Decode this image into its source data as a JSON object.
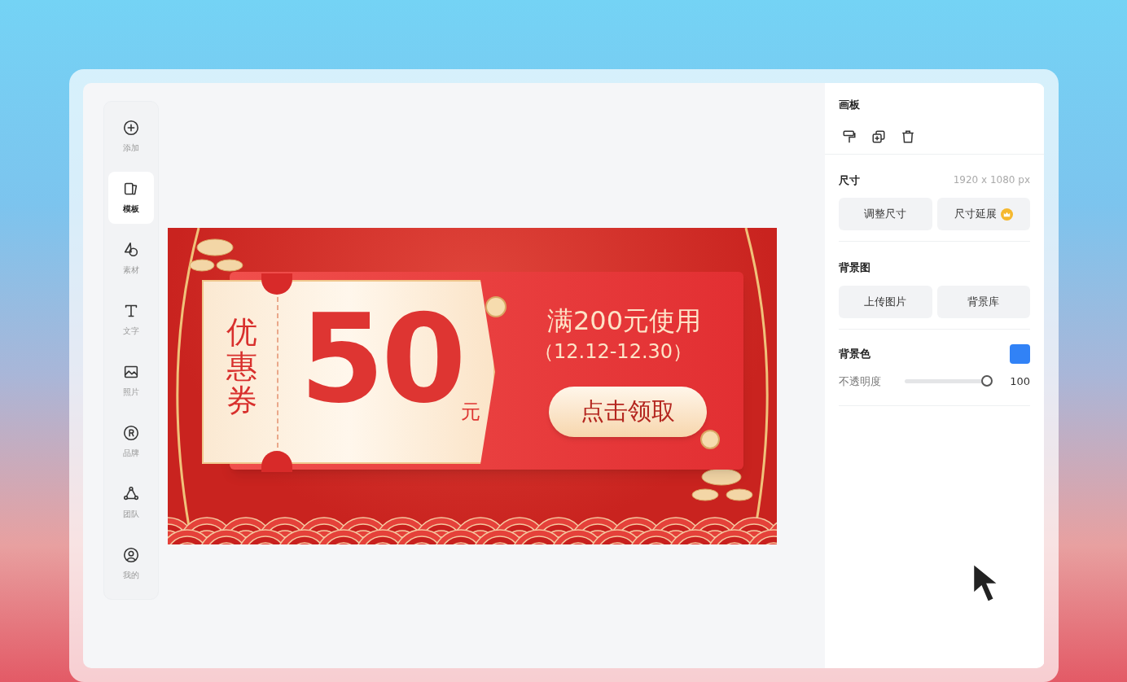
{
  "sidebar": {
    "items": [
      {
        "label": "添加",
        "selected": false
      },
      {
        "label": "模板",
        "selected": true
      },
      {
        "label": "素材",
        "selected": false
      },
      {
        "label": "文字",
        "selected": false
      },
      {
        "label": "照片",
        "selected": false
      },
      {
        "label": "品牌",
        "selected": false
      },
      {
        "label": "团队",
        "selected": false
      },
      {
        "label": "我的",
        "selected": false
      }
    ]
  },
  "banner": {
    "tag": "优惠券",
    "amount": "50",
    "unit": "元",
    "condition": "满200元使用",
    "period": "（12.12-12.30）",
    "cta": "点击领取"
  },
  "panel": {
    "title": "画板",
    "size": {
      "label": "尺寸",
      "value": "1920 x 1080 px",
      "buttons": [
        {
          "label": "调整尺寸",
          "premium": false
        },
        {
          "label": "尺寸延展",
          "premium": true
        }
      ]
    },
    "background_image": {
      "label": "背景图",
      "buttons": [
        {
          "label": "上传图片",
          "premium": false
        },
        {
          "label": "背景库",
          "premium": false
        }
      ]
    },
    "background_color": {
      "label": "背景色",
      "color": "#3182f6"
    },
    "opacity": {
      "label": "不透明度",
      "level": 1.0,
      "reading": "100"
    }
  }
}
